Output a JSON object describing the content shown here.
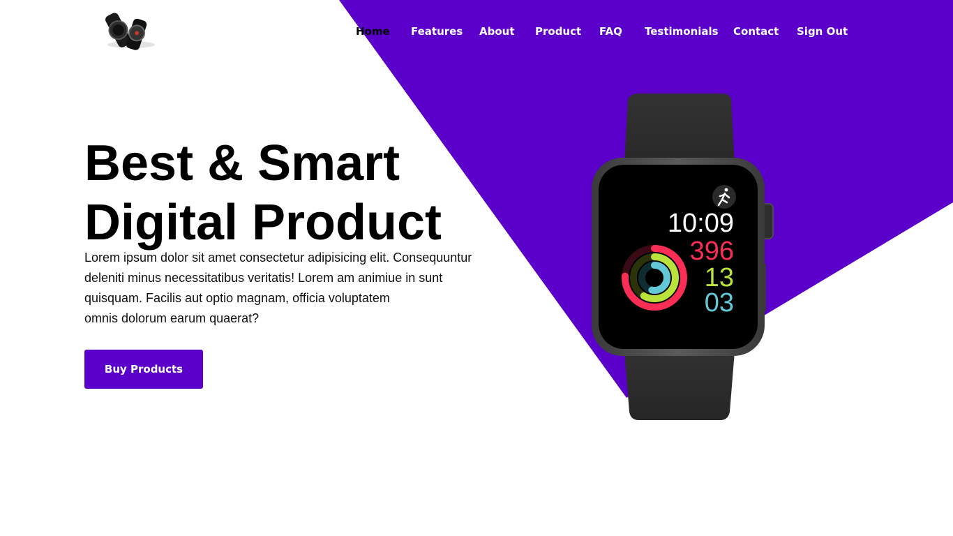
{
  "colors": {
    "accent": "#5b00cb",
    "background": "#ffffff",
    "ring_move": "#fa2d55",
    "ring_exercise": "#b9e33a",
    "ring_stand": "#62c8d6"
  },
  "header": {
    "logo_icon": "watch-logo-icon",
    "nav": [
      {
        "label": "Home",
        "active": true
      },
      {
        "label": "Features"
      },
      {
        "label": "About"
      },
      {
        "label": "Product"
      },
      {
        "label": "FAQ"
      },
      {
        "label": "Testimonials"
      },
      {
        "label": "Contact"
      },
      {
        "label": "Sign Out"
      }
    ]
  },
  "hero": {
    "title_line1": "Best & Smart",
    "title_line2": "Digital Product",
    "text_lines": [
      "Lorem ipsum dolor sit amet consectetur adipisicing elit. Consequuntur",
      "deleniti minus necessitatibus veritatis! Lorem am animiue in sunt",
      "quisquam. Facilis aut optio magnam, officia voluptatem",
      "omnis dolorum earum quaerat?"
    ],
    "button_label": "Buy Products"
  },
  "watch": {
    "time": "10:09",
    "move": "396",
    "exercise": "13",
    "stand": "03",
    "activity_icon": "running-icon"
  }
}
